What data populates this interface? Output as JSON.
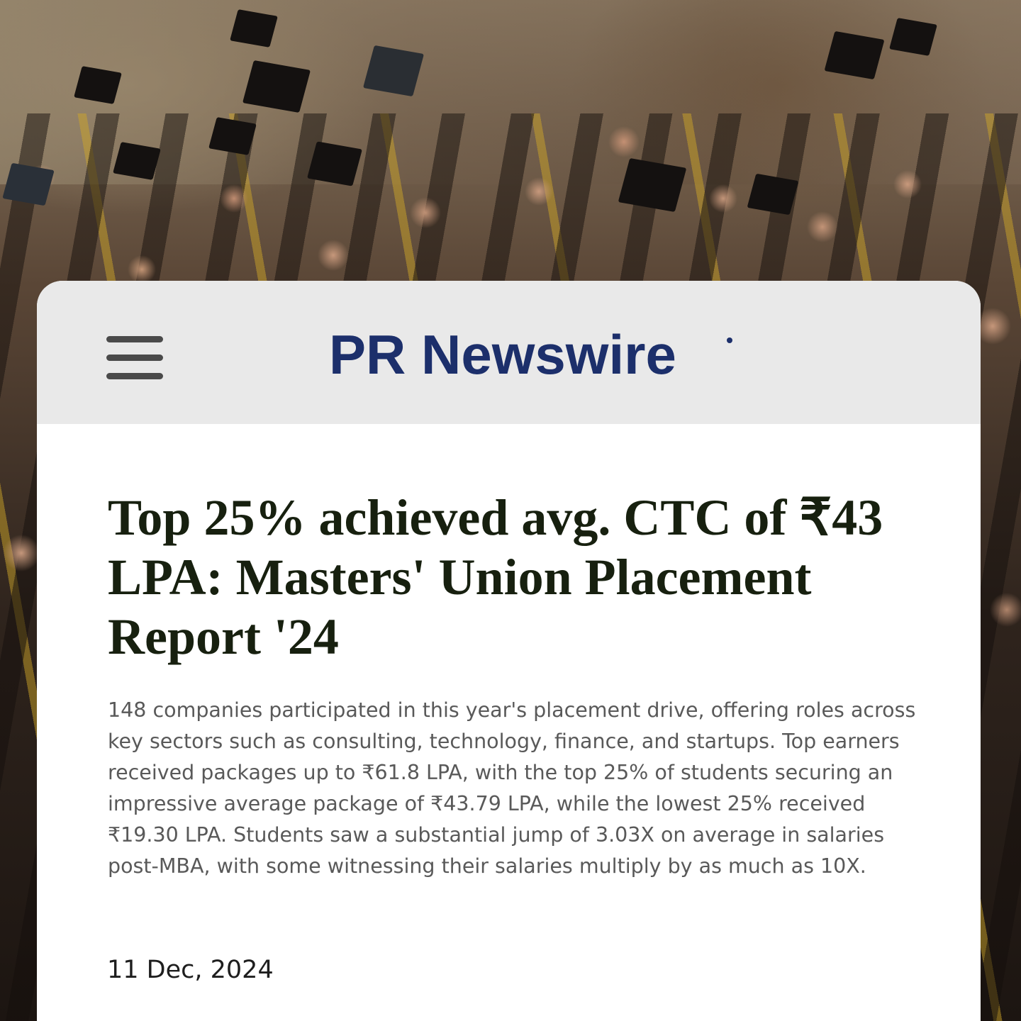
{
  "background": {
    "image_description_icon": "graduation-crowd-photo"
  },
  "header": {
    "menu_icon": "hamburger-menu-icon",
    "logo_text": "PR Newswire",
    "logo_color": "#1c2f6b",
    "background_color": "#e9e9e9"
  },
  "article": {
    "headline": "Top 25% achieved avg. CTC of ₹43 LPA: Masters' Union Placement Report '24",
    "summary": "148 companies participated in this year's placement drive, offering roles across key sectors such as consulting, technology, finance, and startups. Top earners received packages up to ₹61.8 LPA, with the top 25% of students securing an impressive average package of ₹43.79 LPA, while the lowest 25% received ₹19.30 LPA. Students saw a substantial jump of 3.03X on average in salaries post-MBA, with some witnessing their salaries multiply by as much as 10X.",
    "date": "11 Dec, 2024",
    "headline_color": "#17200f",
    "summary_color": "#595959"
  }
}
